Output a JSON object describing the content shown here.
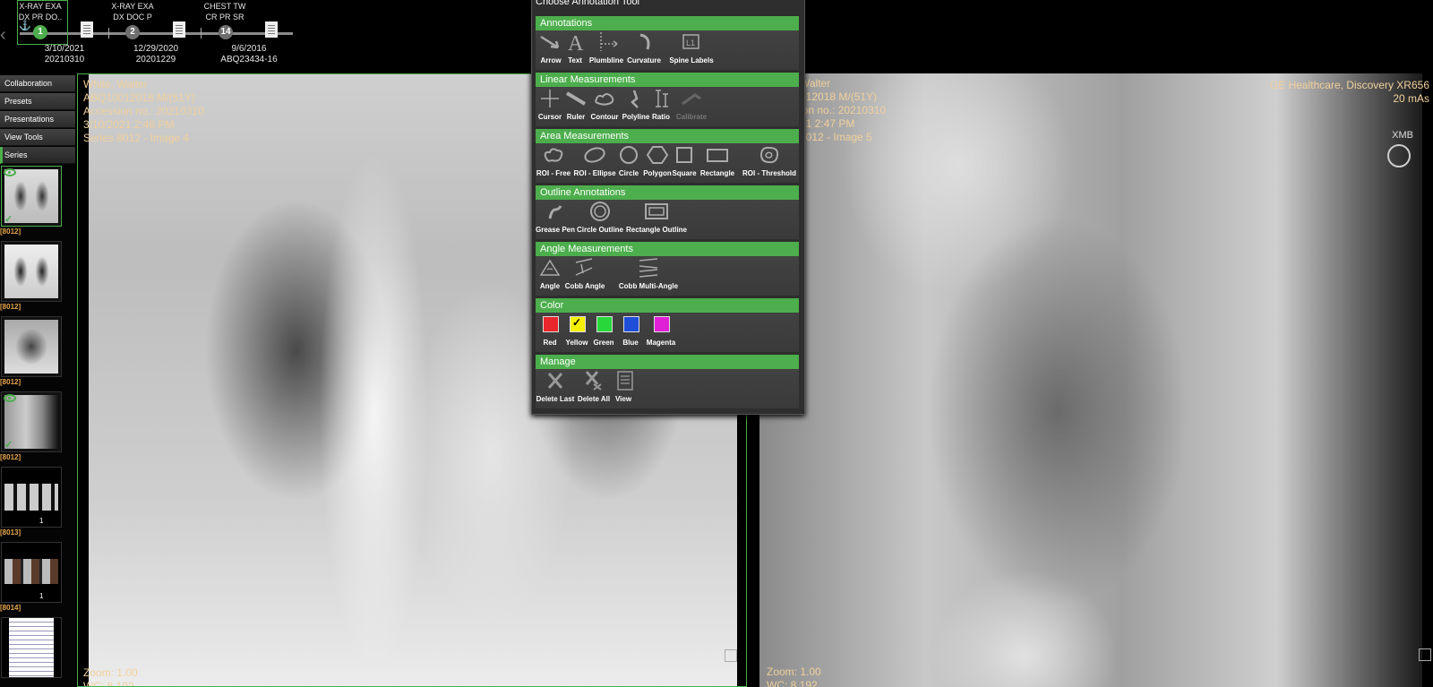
{
  "timeline": {
    "studies": [
      {
        "title_line1": "X-RAY EXA",
        "title_line2": "DX PR DO..",
        "node": "1",
        "date": "3/10/2021",
        "accession": "20210310",
        "node_color": "#4cae4c"
      },
      {
        "title_line1": "X-RAY EXA",
        "title_line2": "DX DOC P",
        "node": "2",
        "date": "12/29/2020",
        "accession": "20201229",
        "node_color": "#6e6e6e"
      },
      {
        "title_line1": "CHEST TW",
        "title_line2": "CR PR SR",
        "node": "14",
        "date": "9/6/2016",
        "accession": "ABQ23434-16",
        "node_color": "#6e6e6e"
      }
    ]
  },
  "sidebar": {
    "buttons": [
      "Collaboration",
      "Presets",
      "Presentations",
      "View Tools",
      "Series"
    ],
    "series": [
      {
        "label": "[8012]",
        "count": "",
        "visible": true,
        "selected": true
      },
      {
        "label": "[8012]",
        "count": "",
        "visible": false,
        "selected": false
      },
      {
        "label": "[8012]",
        "count": "",
        "visible": false,
        "selected": false
      },
      {
        "label": "[8012]",
        "count": "",
        "visible": true,
        "selected": false
      },
      {
        "label": "[8013]",
        "count": "1",
        "visible": false,
        "selected": false
      },
      {
        "label": "[8014]",
        "count": "1",
        "visible": false,
        "selected": false
      },
      {
        "label": "",
        "count": "",
        "visible": false,
        "selected": false
      }
    ]
  },
  "viewport_left": {
    "patient_name": "White, Walter",
    "patient_id": "ABQ10012018 M/(51Y)",
    "accession": "Accession no.: 20210310",
    "datetime": "3/10/2021 2:46 PM",
    "series": "Series 8012 - Image 4",
    "zoom": "Zoom: 1.00",
    "wc": "WC: 8,192"
  },
  "viewport_right": {
    "patient_name": "Walter",
    "patient_id": "012018 M/(51Y)",
    "accession": "ion no.: 20210310",
    "datetime": "21 2:47 PM",
    "series": "8012 - Image 5",
    "manufacturer": "GE Healthcare, Discovery XR656",
    "mas": "20 mAs",
    "marker": "XMB",
    "zoom": "Zoom: 1.00",
    "wc": "WC: 8,192"
  },
  "annotation_panel": {
    "title": "Choose Annotation Tool",
    "sections": {
      "annotations": {
        "heading": "Annotations",
        "tools": [
          "Arrow",
          "Text",
          "Plumbline",
          "Curvature",
          "Spine Labels"
        ]
      },
      "linear": {
        "heading": "Linear Measurements",
        "tools": [
          "Cursor",
          "Ruler",
          "Contour",
          "Polyline",
          "Ratio",
          "Calibrate"
        ]
      },
      "area": {
        "heading": "Area Measurements",
        "tools": [
          "ROI - Free",
          "ROI - Ellipse",
          "Circle",
          "Polygon",
          "Square",
          "Rectangle",
          "ROI - Threshold"
        ]
      },
      "outline": {
        "heading": "Outline Annotations",
        "tools": [
          "Grease Pen",
          "Circle Outline",
          "Rectangle Outline"
        ]
      },
      "angle": {
        "heading": "Angle Measurements",
        "tools": [
          "Angle",
          "Cobb Angle",
          "Cobb Multi-Angle"
        ]
      },
      "color": {
        "heading": "Color",
        "tools": [
          "Red",
          "Yellow",
          "Green",
          "Blue",
          "Magenta"
        ],
        "swatches": [
          "#e8262b",
          "#f4f000",
          "#28d73a",
          "#1f4fd8",
          "#e020d6"
        ],
        "selected": "Yellow"
      },
      "manage": {
        "heading": "Manage",
        "tools": [
          "Delete Last",
          "Delete All",
          "View"
        ]
      }
    }
  }
}
